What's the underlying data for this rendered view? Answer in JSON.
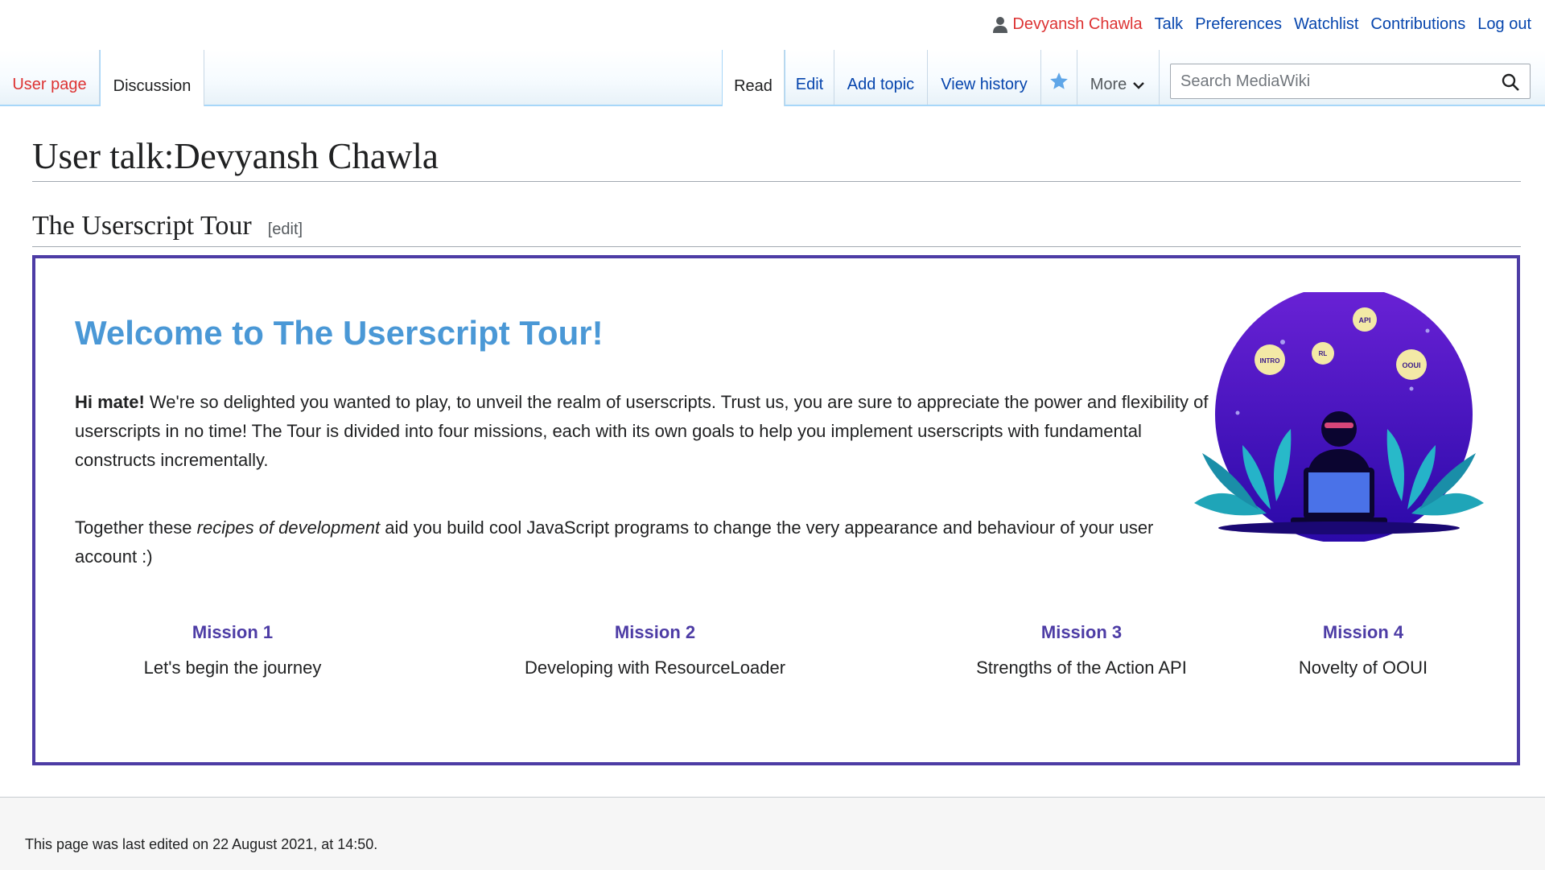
{
  "personal_tools": {
    "username": "Devyansh Chawla",
    "talk": "Talk",
    "preferences": "Preferences",
    "watchlist": "Watchlist",
    "contributions": "Contributions",
    "logout": "Log out"
  },
  "namespace_tabs": [
    "User page",
    "Discussion"
  ],
  "view_tabs": {
    "read": "Read",
    "edit": "Edit",
    "add_topic": "Add topic",
    "view_history": "View history",
    "more": "More"
  },
  "search": {
    "placeholder": "Search MediaWiki"
  },
  "page_title": "User talk:Devyansh Chawla",
  "section": {
    "heading": "The Userscript Tour",
    "edit_link": "[edit]"
  },
  "tour": {
    "welcome": "Welcome to The Userscript Tour!",
    "p1_bold": "Hi mate!",
    "p1_rest": " We're so delighted you wanted to play, to unveil the realm of userscripts. Trust us, you are sure to appreciate the power and flexibility of userscripts in no time! The Tour is divided into four missions, each with its own goals to help you implement userscripts with fundamental constructs incrementally.",
    "p2_start": "Together these ",
    "p2_italic": "recipes of development",
    "p2_end": " aid you build cool JavaScript programs to change the very appearance and behaviour of your user account :)",
    "illustration_labels": [
      "API",
      "INTRO",
      "RL",
      "OOUI"
    ],
    "missions": [
      {
        "title": "Mission 1",
        "desc": "Let's begin the journey"
      },
      {
        "title": "Mission 2",
        "desc": "Developing with ResourceLoader"
      },
      {
        "title": "Mission 3",
        "desc": "Strengths of the Action API"
      },
      {
        "title": "Mission 4",
        "desc": "Novelty of OOUI"
      }
    ]
  },
  "footer": {
    "last_edited": "This page was last edited on 22 August 2021, at 14:50."
  },
  "colors": {
    "link": "#0645ad",
    "new_link": "#dd3333",
    "tour_border": "#4d3ca5",
    "welcome": "#4a98d6"
  },
  "icons": [
    "user-icon",
    "star-icon",
    "chevron-down-icon",
    "search-icon"
  ]
}
